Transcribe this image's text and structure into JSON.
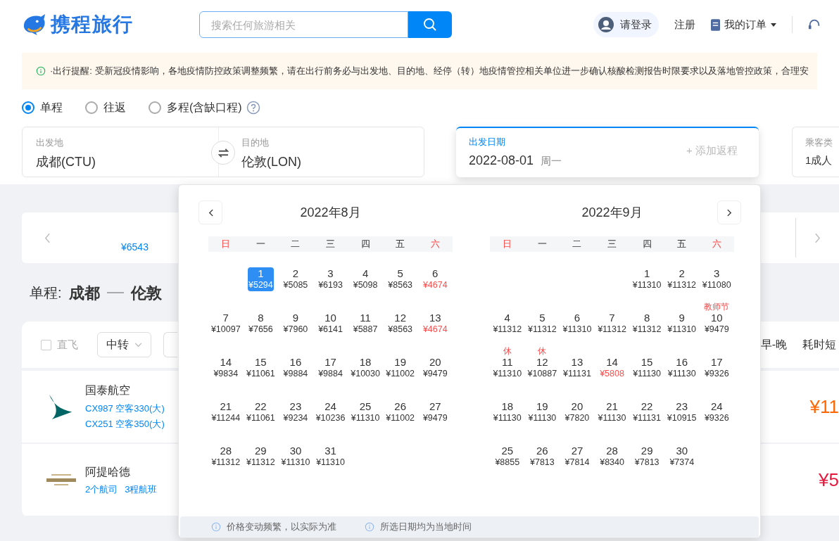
{
  "header": {
    "logo": "携程旅行",
    "search_placeholder": "搜索任何旅游相关",
    "login": "请登录",
    "register": "注册",
    "orders": "我的订单"
  },
  "notice": "·出行提醒: 受新冠疫情影响，各地疫情防控政策调整频繁，请在出行前务必与出发地、目的地、经停（转）地疫情管控相关单位进一步确认核酸检测报告时限要求以及落地管控政策，合理安",
  "trip_types": [
    {
      "label": "单程",
      "selected": true
    },
    {
      "label": "往返",
      "selected": false
    },
    {
      "label": "多程(含缺口程)",
      "selected": false
    }
  ],
  "origin": {
    "label": "出发地",
    "value": "成都(CTU)"
  },
  "destination": {
    "label": "目的地",
    "value": "伦敦(LON)"
  },
  "date": {
    "label": "出发日期",
    "value": "2022-08-01",
    "weekday": "周一",
    "add_return": "+ 添加返程"
  },
  "passenger": {
    "label": "乘客类",
    "value": "1成人"
  },
  "date_strip": {
    "price": "¥6543"
  },
  "route": {
    "label": "单程:",
    "from": "成都",
    "to": "伦敦"
  },
  "filters": {
    "direct": {
      "label": "直飞",
      "checked": false
    },
    "transfer": "中转",
    "sorts": [
      "早-晚",
      "耗时短"
    ]
  },
  "flights": [
    {
      "airline": "国泰航空",
      "kind": "wing",
      "details": [
        "CX987 空客330(大)",
        "CX251 空客350(大)"
      ],
      "price": "¥11",
      "color": "#ff6600"
    },
    {
      "airline": "阿提哈德",
      "kind": "etihad",
      "details": [
        "2个航司",
        "3程航班"
      ],
      "price": "¥5",
      "color": "#e6173d"
    }
  ],
  "calendar": {
    "months": [
      {
        "title": "2022年8月",
        "weekdays": [
          {
            "label": "日",
            "weekend": true
          },
          {
            "label": "一",
            "weekend": false
          },
          {
            "label": "二",
            "weekend": false
          },
          {
            "label": "三",
            "weekend": false
          },
          {
            "label": "四",
            "weekend": false
          },
          {
            "label": "五",
            "weekend": false
          },
          {
            "label": "六",
            "weekend": true
          }
        ],
        "weeks": [
          [
            {
              "kind": "blank"
            },
            {
              "kind": "day",
              "day": "1",
              "price": "¥5294",
              "selected": true,
              "low": false
            },
            {
              "kind": "day",
              "day": "2",
              "price": "¥5085",
              "selected": false,
              "low": false
            },
            {
              "kind": "day",
              "day": "3",
              "price": "¥6193",
              "selected": false,
              "low": false
            },
            {
              "kind": "day",
              "day": "4",
              "price": "¥5098",
              "selected": false,
              "low": false
            },
            {
              "kind": "day",
              "day": "5",
              "price": "¥8563",
              "selected": false,
              "low": false
            },
            {
              "kind": "day",
              "day": "6",
              "price": "¥4674",
              "selected": false,
              "low": true
            }
          ],
          [
            {
              "kind": "day",
              "day": "7",
              "price": "¥10097",
              "selected": false,
              "low": false
            },
            {
              "kind": "day",
              "day": "8",
              "price": "¥7656",
              "selected": false,
              "low": false
            },
            {
              "kind": "day",
              "day": "9",
              "price": "¥7960",
              "selected": false,
              "low": false
            },
            {
              "kind": "day",
              "day": "10",
              "price": "¥6141",
              "selected": false,
              "low": false
            },
            {
              "kind": "day",
              "day": "11",
              "price": "¥5887",
              "selected": false,
              "low": false
            },
            {
              "kind": "day",
              "day": "12",
              "price": "¥8563",
              "selected": false,
              "low": false
            },
            {
              "kind": "day",
              "day": "13",
              "price": "¥4674",
              "selected": false,
              "low": true
            }
          ],
          [
            {
              "kind": "day",
              "day": "14",
              "price": "¥9834",
              "selected": false,
              "low": false
            },
            {
              "kind": "day",
              "day": "15",
              "price": "¥11061",
              "selected": false,
              "low": false
            },
            {
              "kind": "day",
              "day": "16",
              "price": "¥9884",
              "selected": false,
              "low": false
            },
            {
              "kind": "day",
              "day": "17",
              "price": "¥9884",
              "selected": false,
              "low": false
            },
            {
              "kind": "day",
              "day": "18",
              "price": "¥10030",
              "selected": false,
              "low": false
            },
            {
              "kind": "day",
              "day": "19",
              "price": "¥11002",
              "selected": false,
              "low": false
            },
            {
              "kind": "day",
              "day": "20",
              "price": "¥9479",
              "selected": false,
              "low": false
            }
          ],
          [
            {
              "kind": "day",
              "day": "21",
              "price": "¥11244",
              "selected": false,
              "low": false
            },
            {
              "kind": "day",
              "day": "22",
              "price": "¥11061",
              "selected": false,
              "low": false
            },
            {
              "kind": "day",
              "day": "23",
              "price": "¥9234",
              "selected": false,
              "low": false
            },
            {
              "kind": "day",
              "day": "24",
              "price": "¥10236",
              "selected": false,
              "low": false
            },
            {
              "kind": "day",
              "day": "25",
              "price": "¥11310",
              "selected": false,
              "low": false
            },
            {
              "kind": "day",
              "day": "26",
              "price": "¥11002",
              "selected": false,
              "low": false
            },
            {
              "kind": "day",
              "day": "27",
              "price": "¥9479",
              "selected": false,
              "low": false
            }
          ],
          [
            {
              "kind": "day",
              "day": "28",
              "price": "¥11312",
              "selected": false,
              "low": false
            },
            {
              "kind": "day",
              "day": "29",
              "price": "¥11312",
              "selected": false,
              "low": false
            },
            {
              "kind": "day",
              "day": "30",
              "price": "¥11310",
              "selected": false,
              "low": false
            },
            {
              "kind": "day",
              "day": "31",
              "price": "¥11310",
              "selected": false,
              "low": false
            }
          ]
        ]
      },
      {
        "title": "2022年9月",
        "weekdays": [
          {
            "label": "日",
            "weekend": true
          },
          {
            "label": "一",
            "weekend": false
          },
          {
            "label": "二",
            "weekend": false
          },
          {
            "label": "三",
            "weekend": false
          },
          {
            "label": "四",
            "weekend": false
          },
          {
            "label": "五",
            "weekend": false
          },
          {
            "label": "六",
            "weekend": true
          }
        ],
        "weeks": [
          [
            {
              "kind": "blank"
            },
            {
              "kind": "blank"
            },
            {
              "kind": "blank"
            },
            {
              "kind": "blank"
            },
            {
              "kind": "day",
              "day": "1",
              "price": "¥11310",
              "selected": false,
              "low": false
            },
            {
              "kind": "day",
              "day": "2",
              "price": "¥11312",
              "selected": false,
              "low": false
            },
            {
              "kind": "day",
              "day": "3",
              "price": "¥11080",
              "selected": false,
              "low": false
            }
          ],
          [
            {
              "kind": "day",
              "day": "4",
              "price": "¥11312",
              "selected": false,
              "low": false
            },
            {
              "kind": "day",
              "day": "5",
              "price": "¥11312",
              "selected": false,
              "low": false
            },
            {
              "kind": "day",
              "day": "6",
              "price": "¥11310",
              "selected": false,
              "low": false
            },
            {
              "kind": "day",
              "day": "7",
              "price": "¥11312",
              "selected": false,
              "low": false
            },
            {
              "kind": "day",
              "day": "8",
              "price": "¥11312",
              "selected": false,
              "low": false
            },
            {
              "kind": "day",
              "day": "9",
              "price": "¥11310",
              "selected": false,
              "low": false
            },
            {
              "kind": "day",
              "day": "10",
              "price": "¥9479",
              "selected": false,
              "low": false,
              "note": "教师节"
            }
          ],
          [
            {
              "kind": "day",
              "day": "11",
              "price": "¥11310",
              "selected": false,
              "low": false,
              "note": "休"
            },
            {
              "kind": "day",
              "day": "12",
              "price": "¥10887",
              "selected": false,
              "low": false,
              "note": "休"
            },
            {
              "kind": "day",
              "day": "13",
              "price": "¥11131",
              "selected": false,
              "low": false
            },
            {
              "kind": "day",
              "day": "14",
              "price": "¥5808",
              "selected": false,
              "low": true
            },
            {
              "kind": "day",
              "day": "15",
              "price": "¥11130",
              "selected": false,
              "low": false
            },
            {
              "kind": "day",
              "day": "16",
              "price": "¥11130",
              "selected": false,
              "low": false
            },
            {
              "kind": "day",
              "day": "17",
              "price": "¥9326",
              "selected": false,
              "low": false
            }
          ],
          [
            {
              "kind": "day",
              "day": "18",
              "price": "¥11130",
              "selected": false,
              "low": false
            },
            {
              "kind": "day",
              "day": "19",
              "price": "¥11130",
              "selected": false,
              "low": false
            },
            {
              "kind": "day",
              "day": "20",
              "price": "¥7820",
              "selected": false,
              "low": false
            },
            {
              "kind": "day",
              "day": "21",
              "price": "¥11130",
              "selected": false,
              "low": false
            },
            {
              "kind": "day",
              "day": "22",
              "price": "¥11131",
              "selected": false,
              "low": false
            },
            {
              "kind": "day",
              "day": "23",
              "price": "¥10915",
              "selected": false,
              "low": false
            },
            {
              "kind": "day",
              "day": "24",
              "price": "¥9326",
              "selected": false,
              "low": false
            }
          ],
          [
            {
              "kind": "day",
              "day": "25",
              "price": "¥8855",
              "selected": false,
              "low": false
            },
            {
              "kind": "day",
              "day": "26",
              "price": "¥7813",
              "selected": false,
              "low": false
            },
            {
              "kind": "day",
              "day": "27",
              "price": "¥7814",
              "selected": false,
              "low": false
            },
            {
              "kind": "day",
              "day": "28",
              "price": "¥8340",
              "selected": false,
              "low": false
            },
            {
              "kind": "day",
              "day": "29",
              "price": "¥7813",
              "selected": false,
              "low": false
            },
            {
              "kind": "day",
              "day": "30",
              "price": "¥7374",
              "selected": false,
              "low": false
            }
          ]
        ]
      }
    ],
    "footer_notes": [
      "价格变动频繁，以实际为准",
      "所选日期均为当地时间"
    ]
  }
}
